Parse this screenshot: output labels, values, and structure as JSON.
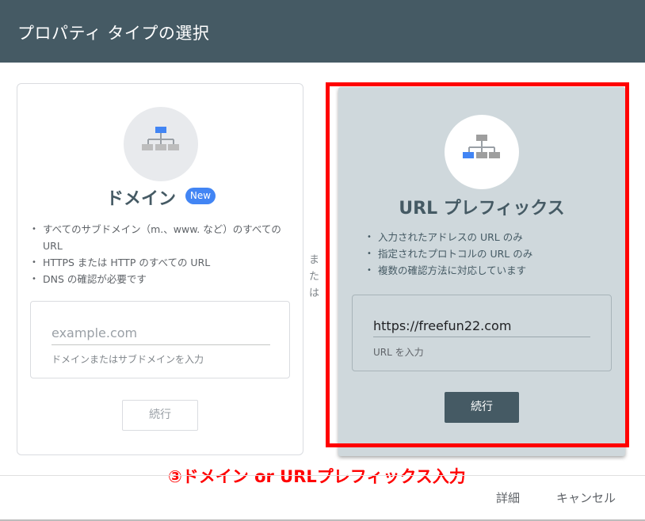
{
  "dialog": {
    "title": "プロパティ タイプの選択"
  },
  "domain_card": {
    "title": "ドメイン",
    "badge": "New",
    "features": [
      "すべてのサブドメイン（m.、www. など）のすべての URL",
      "HTTPS または HTTP のすべての URL",
      "DNS の確認が必要です"
    ],
    "input_placeholder": "example.com",
    "input_help": "ドメインまたはサブドメインを入力",
    "continue_label": "続行"
  },
  "or_label": "または",
  "url_card": {
    "title": "URL プレフィックス",
    "features": [
      "入力されたアドレスの URL のみ",
      "指定されたプロトコルの URL のみ",
      "複数の確認方法に対応しています"
    ],
    "input_value": "https://freefun22.com",
    "input_help": "URL を入力",
    "continue_label": "続行"
  },
  "annotation": "③ドメイン or URLプレフィックス入力",
  "footer": {
    "details_label": "詳細",
    "cancel_label": "キャンセル"
  },
  "colors": {
    "header": "#455a64",
    "selected_card": "#cfd8dc",
    "badge": "#4285f4",
    "icon_highlight": "#4285f4",
    "annotation": "#ff0000"
  },
  "icons": {
    "domain_icon": "sitemap-icon-top-highlighted",
    "url_icon": "sitemap-icon-leaf-highlighted"
  }
}
